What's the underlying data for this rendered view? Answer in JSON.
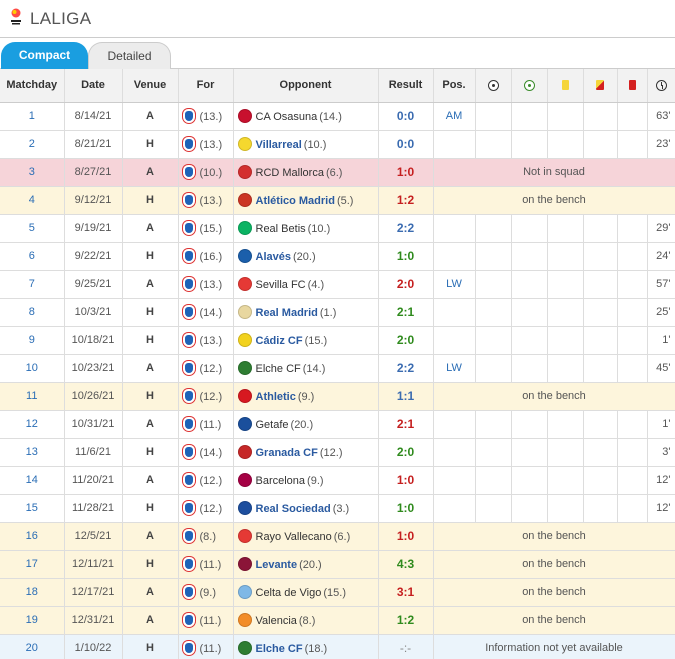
{
  "league": {
    "name": "LALIGA"
  },
  "tabs": [
    {
      "label": "Compact",
      "active": true
    },
    {
      "label": "Detailed",
      "active": false
    }
  ],
  "columns": {
    "matchday": "Matchday",
    "date": "Date",
    "venue": "Venue",
    "for": "For",
    "opponent": "Opponent",
    "result": "Result",
    "pos": "Pos.",
    "goals_icon": "ball-icon",
    "assists_icon": "assist-ball-icon",
    "yellow_icon": "yellow-card-icon",
    "second_yellow_icon": "yellow-red-card-icon",
    "red_icon": "red-card-icon",
    "minutes_icon": "clock-icon"
  },
  "rows": [
    {
      "md": "1",
      "date": "8/14/21",
      "venue": "A",
      "for_rank": "(13.)",
      "opponent": "CA Osasuna",
      "opp_rank": "(14.)",
      "result": "0:0",
      "result_type": "draw",
      "pos": "AM",
      "goals": "",
      "assists": "",
      "yellow": "",
      "second_yellow": "",
      "red": "",
      "minutes": "63'",
      "status": "played",
      "note": "",
      "opp_color": "#c8102e"
    },
    {
      "md": "2",
      "date": "8/21/21",
      "venue": "H",
      "for_rank": "(13.)",
      "opponent": "Villarreal",
      "opp_rank": "(10.)",
      "result": "0:0",
      "result_type": "draw",
      "pos": "",
      "goals": "",
      "assists": "",
      "yellow": "",
      "second_yellow": "",
      "red": "",
      "minutes": "23'",
      "status": "played",
      "note": "",
      "opp_color": "#f5d82e"
    },
    {
      "md": "3",
      "date": "8/27/21",
      "venue": "A",
      "for_rank": "(10.)",
      "opponent": "RCD Mallorca",
      "opp_rank": "(6.)",
      "result": "1:0",
      "result_type": "loss",
      "pos": "",
      "goals": "",
      "assists": "",
      "yellow": "",
      "second_yellow": "",
      "red": "",
      "minutes": "",
      "status": "notsquad",
      "note": "Not in squad",
      "opp_color": "#d32f2f"
    },
    {
      "md": "4",
      "date": "9/12/21",
      "venue": "H",
      "for_rank": "(13.)",
      "opponent": "Atlético Madrid",
      "opp_rank": "(5.)",
      "result": "1:2",
      "result_type": "loss",
      "pos": "",
      "goals": "",
      "assists": "",
      "yellow": "",
      "second_yellow": "",
      "red": "",
      "minutes": "",
      "status": "bench",
      "note": "on the bench",
      "opp_color": "#cb3524"
    },
    {
      "md": "5",
      "date": "9/19/21",
      "venue": "A",
      "for_rank": "(15.)",
      "opponent": "Real Betis",
      "opp_rank": "(10.)",
      "result": "2:2",
      "result_type": "draw",
      "pos": "",
      "goals": "",
      "assists": "",
      "yellow": "",
      "second_yellow": "",
      "red": "",
      "minutes": "29'",
      "status": "played",
      "note": "",
      "opp_color": "#0bb363"
    },
    {
      "md": "6",
      "date": "9/22/21",
      "venue": "H",
      "for_rank": "(16.)",
      "opponent": "Alavés",
      "opp_rank": "(20.)",
      "result": "1:0",
      "result_type": "win",
      "pos": "",
      "goals": "",
      "assists": "",
      "yellow": "",
      "second_yellow": "",
      "red": "",
      "minutes": "24'",
      "status": "played",
      "note": "",
      "opp_color": "#1b5fab"
    },
    {
      "md": "7",
      "date": "9/25/21",
      "venue": "A",
      "for_rank": "(13.)",
      "opponent": "Sevilla FC",
      "opp_rank": "(4.)",
      "result": "2:0",
      "result_type": "loss",
      "pos": "LW",
      "goals": "",
      "assists": "",
      "yellow": "",
      "second_yellow": "",
      "red": "",
      "minutes": "57'",
      "status": "played",
      "note": "",
      "opp_color": "#e53935"
    },
    {
      "md": "8",
      "date": "10/3/21",
      "venue": "H",
      "for_rank": "(14.)",
      "opponent": "Real Madrid",
      "opp_rank": "(1.)",
      "result": "2:1",
      "result_type": "win",
      "pos": "",
      "goals": "",
      "assists": "",
      "yellow": "",
      "second_yellow": "",
      "red": "",
      "minutes": "25'",
      "status": "played",
      "note": "",
      "opp_color": "#e8d7a0"
    },
    {
      "md": "9",
      "date": "10/18/21",
      "venue": "H",
      "for_rank": "(13.)",
      "opponent": "Cádiz CF",
      "opp_rank": "(15.)",
      "result": "2:0",
      "result_type": "win",
      "pos": "",
      "goals": "",
      "assists": "",
      "yellow": "",
      "second_yellow": "",
      "red": "",
      "minutes": "1'",
      "status": "played",
      "note": "",
      "opp_color": "#f2d21e"
    },
    {
      "md": "10",
      "date": "10/23/21",
      "venue": "A",
      "for_rank": "(12.)",
      "opponent": "Elche CF",
      "opp_rank": "(14.)",
      "result": "2:2",
      "result_type": "draw",
      "pos": "LW",
      "goals": "",
      "assists": "",
      "yellow": "",
      "second_yellow": "",
      "red": "",
      "minutes": "45'",
      "status": "played",
      "note": "",
      "opp_color": "#2e7d32"
    },
    {
      "md": "11",
      "date": "10/26/21",
      "venue": "H",
      "for_rank": "(12.)",
      "opponent": "Athletic",
      "opp_rank": "(9.)",
      "result": "1:1",
      "result_type": "draw",
      "pos": "",
      "goals": "",
      "assists": "",
      "yellow": "",
      "second_yellow": "",
      "red": "",
      "minutes": "",
      "status": "bench",
      "note": "on the bench",
      "opp_color": "#d71920"
    },
    {
      "md": "12",
      "date": "10/31/21",
      "venue": "A",
      "for_rank": "(11.)",
      "opponent": "Getafe",
      "opp_rank": "(20.)",
      "result": "2:1",
      "result_type": "loss",
      "pos": "",
      "goals": "",
      "assists": "",
      "yellow": "",
      "second_yellow": "",
      "red": "",
      "minutes": "1'",
      "status": "played",
      "note": "",
      "opp_color": "#1a4f9c"
    },
    {
      "md": "13",
      "date": "11/6/21",
      "venue": "H",
      "for_rank": "(14.)",
      "opponent": "Granada CF",
      "opp_rank": "(12.)",
      "result": "2:0",
      "result_type": "win",
      "pos": "",
      "goals": "",
      "assists": "",
      "yellow": "",
      "second_yellow": "",
      "red": "",
      "minutes": "3'",
      "status": "played",
      "note": "",
      "opp_color": "#c62828"
    },
    {
      "md": "14",
      "date": "11/20/21",
      "venue": "A",
      "for_rank": "(12.)",
      "opponent": "Barcelona",
      "opp_rank": "(9.)",
      "result": "1:0",
      "result_type": "loss",
      "pos": "",
      "goals": "",
      "assists": "",
      "yellow": "",
      "second_yellow": "",
      "red": "",
      "minutes": "12'",
      "status": "played",
      "note": "",
      "opp_color": "#a50044"
    },
    {
      "md": "15",
      "date": "11/28/21",
      "venue": "H",
      "for_rank": "(12.)",
      "opponent": "Real Sociedad",
      "opp_rank": "(3.)",
      "result": "1:0",
      "result_type": "win",
      "pos": "",
      "goals": "",
      "assists": "",
      "yellow": "",
      "second_yellow": "",
      "red": "",
      "minutes": "12'",
      "status": "played",
      "note": "",
      "opp_color": "#1d4e9e"
    },
    {
      "md": "16",
      "date": "12/5/21",
      "venue": "A",
      "for_rank": "(8.)",
      "opponent": "Rayo Vallecano",
      "opp_rank": "(6.)",
      "result": "1:0",
      "result_type": "loss",
      "pos": "",
      "goals": "",
      "assists": "",
      "yellow": "",
      "second_yellow": "",
      "red": "",
      "minutes": "",
      "status": "bench",
      "note": "on the bench",
      "opp_color": "#e53935"
    },
    {
      "md": "17",
      "date": "12/11/21",
      "venue": "H",
      "for_rank": "(11.)",
      "opponent": "Levante",
      "opp_rank": "(20.)",
      "result": "4:3",
      "result_type": "win",
      "pos": "",
      "goals": "",
      "assists": "",
      "yellow": "",
      "second_yellow": "",
      "red": "",
      "minutes": "",
      "status": "bench",
      "note": "on the bench",
      "opp_color": "#8b1538"
    },
    {
      "md": "18",
      "date": "12/17/21",
      "venue": "A",
      "for_rank": "(9.)",
      "opponent": "Celta de Vigo",
      "opp_rank": "(15.)",
      "result": "3:1",
      "result_type": "loss",
      "pos": "",
      "goals": "",
      "assists": "",
      "yellow": "",
      "second_yellow": "",
      "red": "",
      "minutes": "",
      "status": "bench",
      "note": "on the bench",
      "opp_color": "#7fb8e6"
    },
    {
      "md": "19",
      "date": "12/31/21",
      "venue": "A",
      "for_rank": "(11.)",
      "opponent": "Valencia",
      "opp_rank": "(8.)",
      "result": "1:2",
      "result_type": "win",
      "pos": "",
      "goals": "",
      "assists": "",
      "yellow": "",
      "second_yellow": "",
      "red": "",
      "minutes": "",
      "status": "bench",
      "note": "on the bench",
      "opp_color": "#f28c28"
    },
    {
      "md": "20",
      "date": "1/10/22",
      "venue": "H",
      "for_rank": "(11.)",
      "opponent": "Elche CF",
      "opp_rank": "(18.)",
      "result": "-:-",
      "result_type": "future",
      "pos": "",
      "goals": "",
      "assists": "",
      "yellow": "",
      "second_yellow": "",
      "red": "",
      "minutes": "",
      "status": "future",
      "note": "Information not yet available",
      "opp_color": "#2e7d32"
    }
  ]
}
